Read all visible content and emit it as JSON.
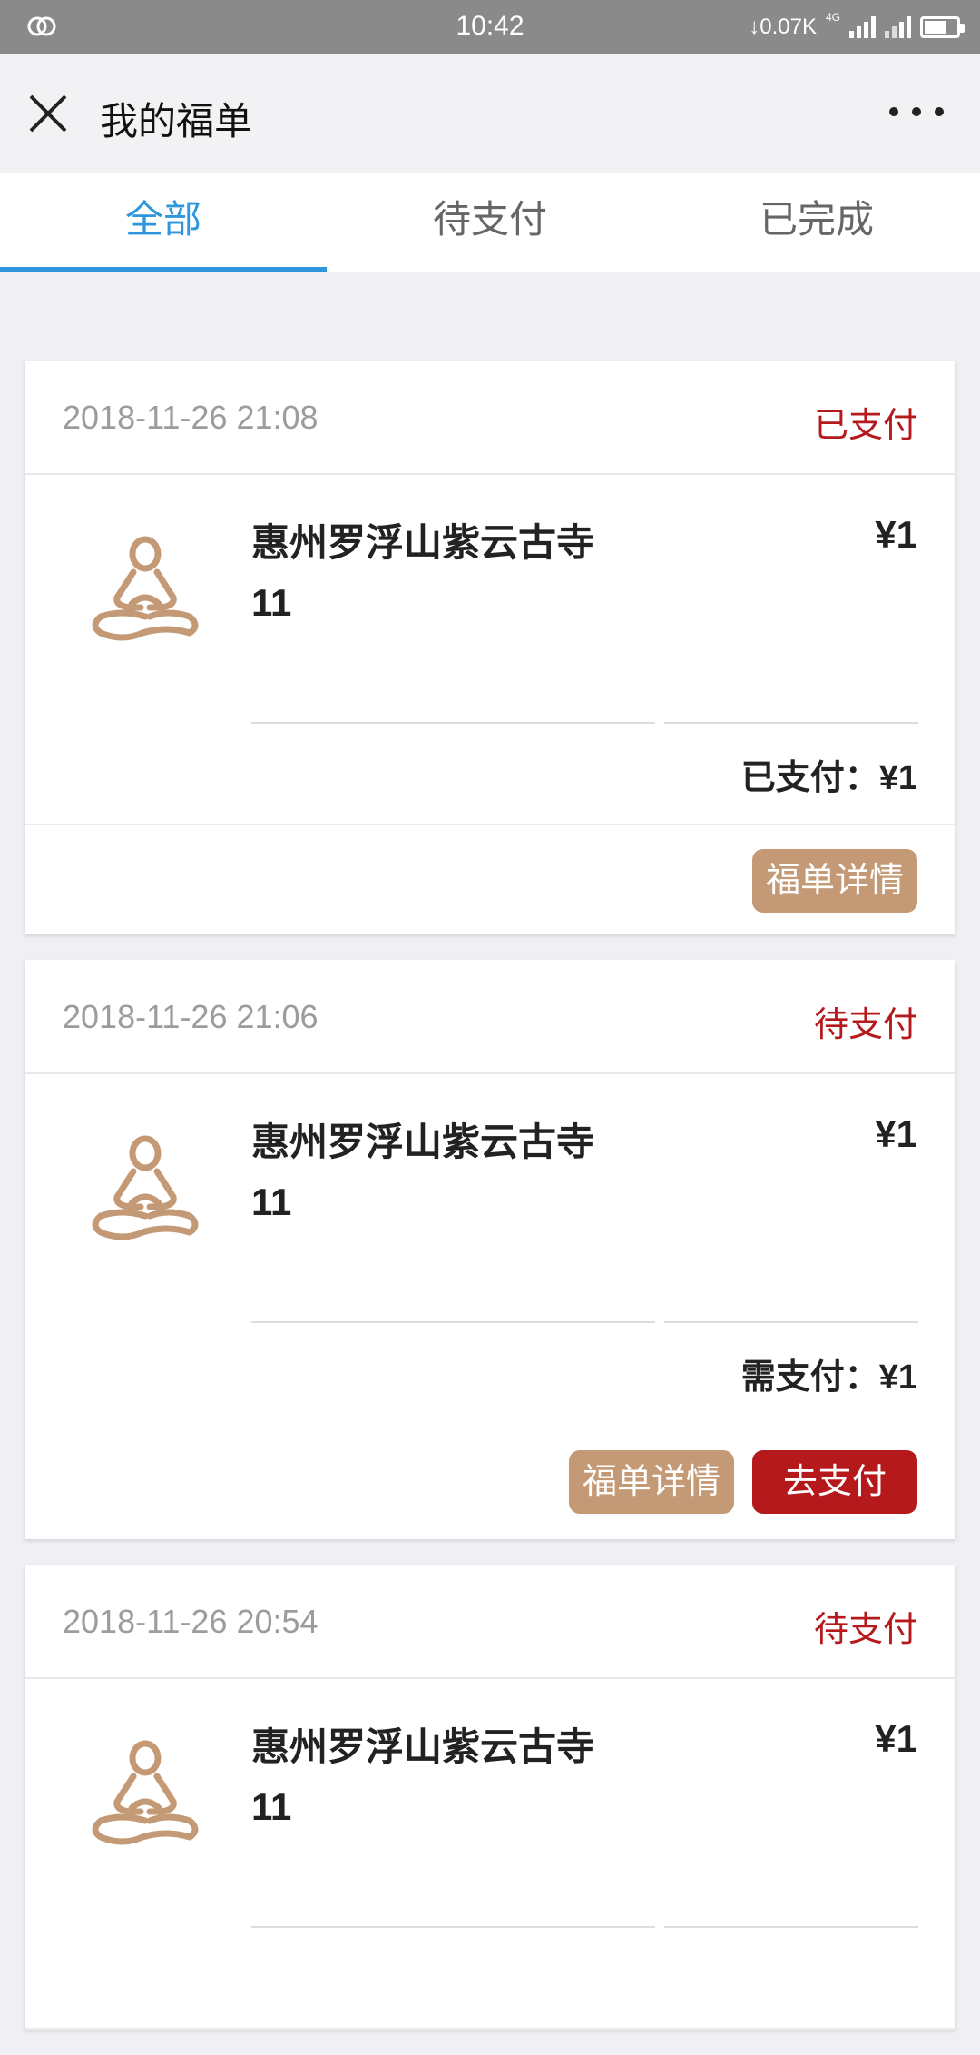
{
  "status_bar": {
    "time": "10:42",
    "net_speed": "↓0.07K",
    "network": "4G",
    "icons": [
      "link-icon",
      "signal-icon",
      "signal-icon-2",
      "battery-icon"
    ]
  },
  "navbar": {
    "title": "我的福单",
    "close_icon": "close-icon",
    "more_icon": "more-icon"
  },
  "tabs": [
    {
      "label": "全部",
      "active": true
    },
    {
      "label": "待支付",
      "active": false
    },
    {
      "label": "已完成",
      "active": false
    }
  ],
  "orders": [
    {
      "date": "2018-11-26 21:08",
      "status": "已支付",
      "name_line1": "惠州罗浮山紫云古寺",
      "name_line2": "11",
      "price": "¥1",
      "summary": "已支付：¥1",
      "detail_button": "福单详情"
    },
    {
      "date": "2018-11-26 21:06",
      "status": "待支付",
      "name_line1": "惠州罗浮山紫云古寺",
      "name_line2": "11",
      "price": "¥1",
      "summary": "需支付：¥1",
      "detail_button": "福单详情",
      "pay_button": "去支付"
    },
    {
      "date": "2018-11-26 20:54",
      "status": "待支付",
      "name_line1": "惠州罗浮山紫云古寺",
      "name_line2": "11",
      "price": "¥1"
    }
  ],
  "colors": {
    "accent_blue": "#2d96dc",
    "status_red": "#b5191c",
    "detail_brown": "#c49a76",
    "logo_brown": "#c49a76"
  }
}
